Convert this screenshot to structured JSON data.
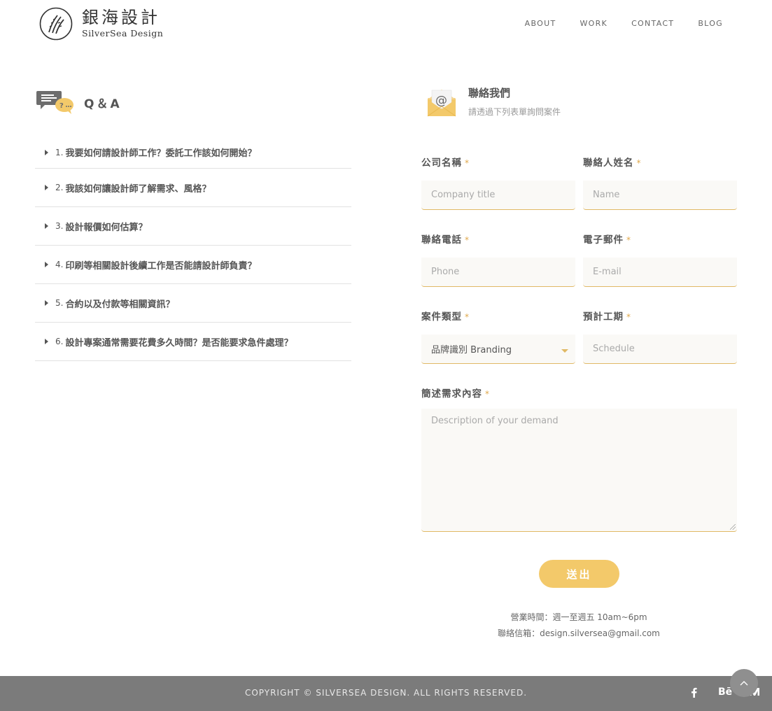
{
  "header": {
    "logo_cn": "銀海設計",
    "logo_en": "SilverSea Design",
    "nav": [
      "ABOUT",
      "WORK",
      "CONTACT",
      "BLOG"
    ]
  },
  "qa": {
    "title": "Q＆A",
    "items": [
      {
        "num": "1.",
        "text": "我要如何請設計師工作？委託工作該如何開始？"
      },
      {
        "num": "2.",
        "text": "我該如何讓設計師了解需求、風格？"
      },
      {
        "num": "3.",
        "text": "設計報價如何估算？"
      },
      {
        "num": "4.",
        "text": "印刷等相關設計後續工作是否能請設計師負責？"
      },
      {
        "num": "5.",
        "text": "合約以及付款等相關資訊？"
      },
      {
        "num": "6.",
        "text": "設計專案通常需要花費多久時間？是否能要求急件處理？"
      }
    ]
  },
  "contact": {
    "title": "聯絡我們",
    "subtitle": "請透過下列表單詢問案件",
    "required_mark": "*",
    "fields": {
      "company": {
        "label": "公司名稱",
        "placeholder": "Company title"
      },
      "name": {
        "label": "聯絡人姓名",
        "placeholder": "Name"
      },
      "phone": {
        "label": "聯絡電話",
        "placeholder": "Phone"
      },
      "email": {
        "label": "電子郵件",
        "placeholder": "E-mail"
      },
      "type": {
        "label": "案件類型",
        "value": "品牌識別 Branding"
      },
      "schedule": {
        "label": "預計工期",
        "placeholder": "Schedule"
      },
      "desc": {
        "label": "簡述需求內容",
        "placeholder": "Description of your demand"
      }
    },
    "submit_label": "送出",
    "hours": "營業時間：週一至週五 10am~6pm",
    "email_info": "聯絡信箱：design.silversea@gmail.com"
  },
  "footer": {
    "copyright": "COPYRIGHT © SILVERSEA DESIGN. ALL RIGHTS RESERVED.",
    "social": [
      "facebook-icon",
      "behance-icon",
      "medium-icon"
    ],
    "behance_label": "Bē"
  },
  "colors": {
    "accent": "#f3c96a",
    "line": "#e0b965",
    "footer": "#7b7b7b"
  }
}
